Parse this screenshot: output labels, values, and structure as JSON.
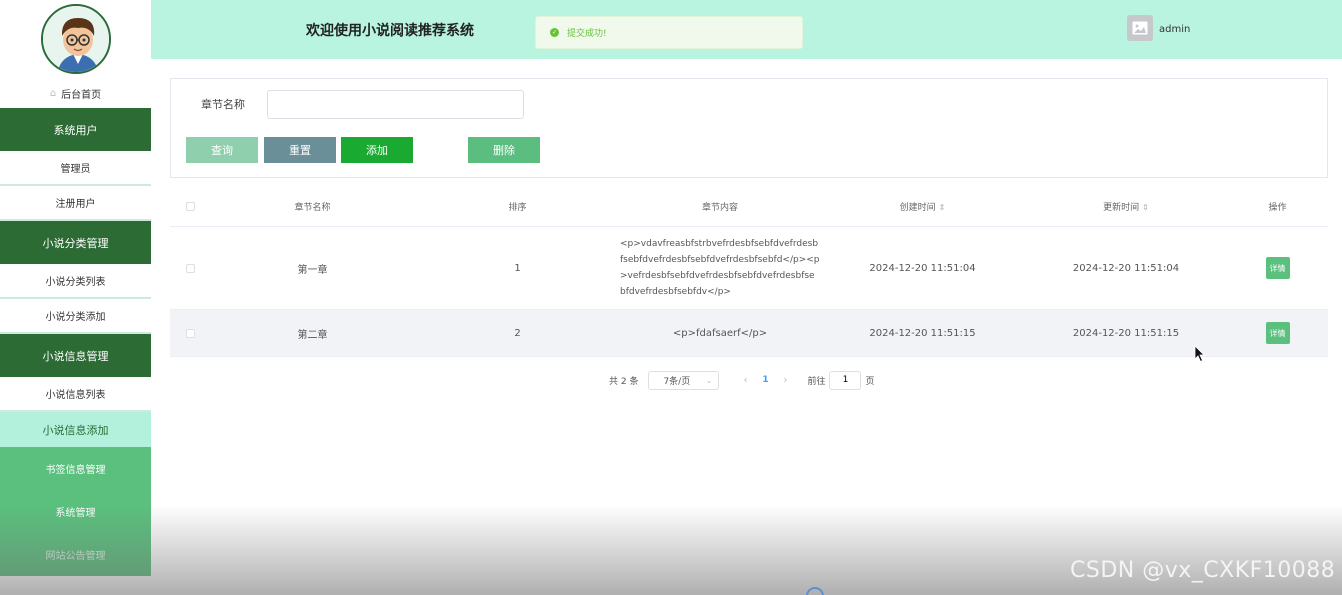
{
  "header": {
    "title": "欢迎使用小说阅读推荐系统",
    "toast": "提交成功!",
    "username": "admin"
  },
  "sidebar": {
    "home": "后台首页",
    "items": [
      {
        "label": "系统用户",
        "type": "group"
      },
      {
        "label": "管理员",
        "type": "sub"
      },
      {
        "label": "注册用户",
        "type": "sub"
      },
      {
        "label": "小说分类管理",
        "type": "group"
      },
      {
        "label": "小说分类列表",
        "type": "sub"
      },
      {
        "label": "小说分类添加",
        "type": "sub"
      },
      {
        "label": "小说信息管理",
        "type": "group"
      },
      {
        "label": "小说信息列表",
        "type": "sub"
      },
      {
        "label": "小说信息添加",
        "type": "sub-active"
      },
      {
        "label": "书签信息管理",
        "type": "light"
      },
      {
        "label": "系统管理",
        "type": "light"
      },
      {
        "label": "网站公告管理",
        "type": "light-dim"
      }
    ]
  },
  "search": {
    "label": "章节名称",
    "value": "",
    "buttons": {
      "query": "查询",
      "reset": "重置",
      "add": "添加",
      "delete": "删除"
    }
  },
  "table": {
    "headers": {
      "name": "章节名称",
      "sort": "排序",
      "content": "章节内容",
      "created": "创建时间",
      "updated": "更新时间",
      "ops": "操作"
    },
    "rows": [
      {
        "name": "第一章",
        "sort": "1",
        "content": "<p>vdavfreasbfstrbvefrdesbfsebfdvefrdesbfsebfdvefrdesbfsebfdvefrdesbfsebfd</p><p>vefrdesbfsebfdvefrdesbfsebfdvefrdesbfsebfdvefrdesbfsebfdv</p>",
        "created": "2024-12-20 11:51:04",
        "updated": "2024-12-20 11:51:04",
        "action": "详情"
      },
      {
        "name": "第二章",
        "sort": "2",
        "content": "<p>fdafsaerf</p>",
        "created": "2024-12-20 11:51:15",
        "updated": "2024-12-20 11:51:15",
        "action": "详情"
      }
    ]
  },
  "pagination": {
    "total": "共 2 条",
    "page_size": "7条/页",
    "current_page": "1",
    "goto_label": "前往",
    "goto_value": "1",
    "page_suffix": "页"
  },
  "watermark": "CSDN @vx_CXKF10088",
  "colors": {
    "header_bg": "#b8f4e0",
    "sidebar_group": "#2d6b35",
    "sidebar_light": "#5bc07e",
    "add_button": "#1aaa32"
  }
}
